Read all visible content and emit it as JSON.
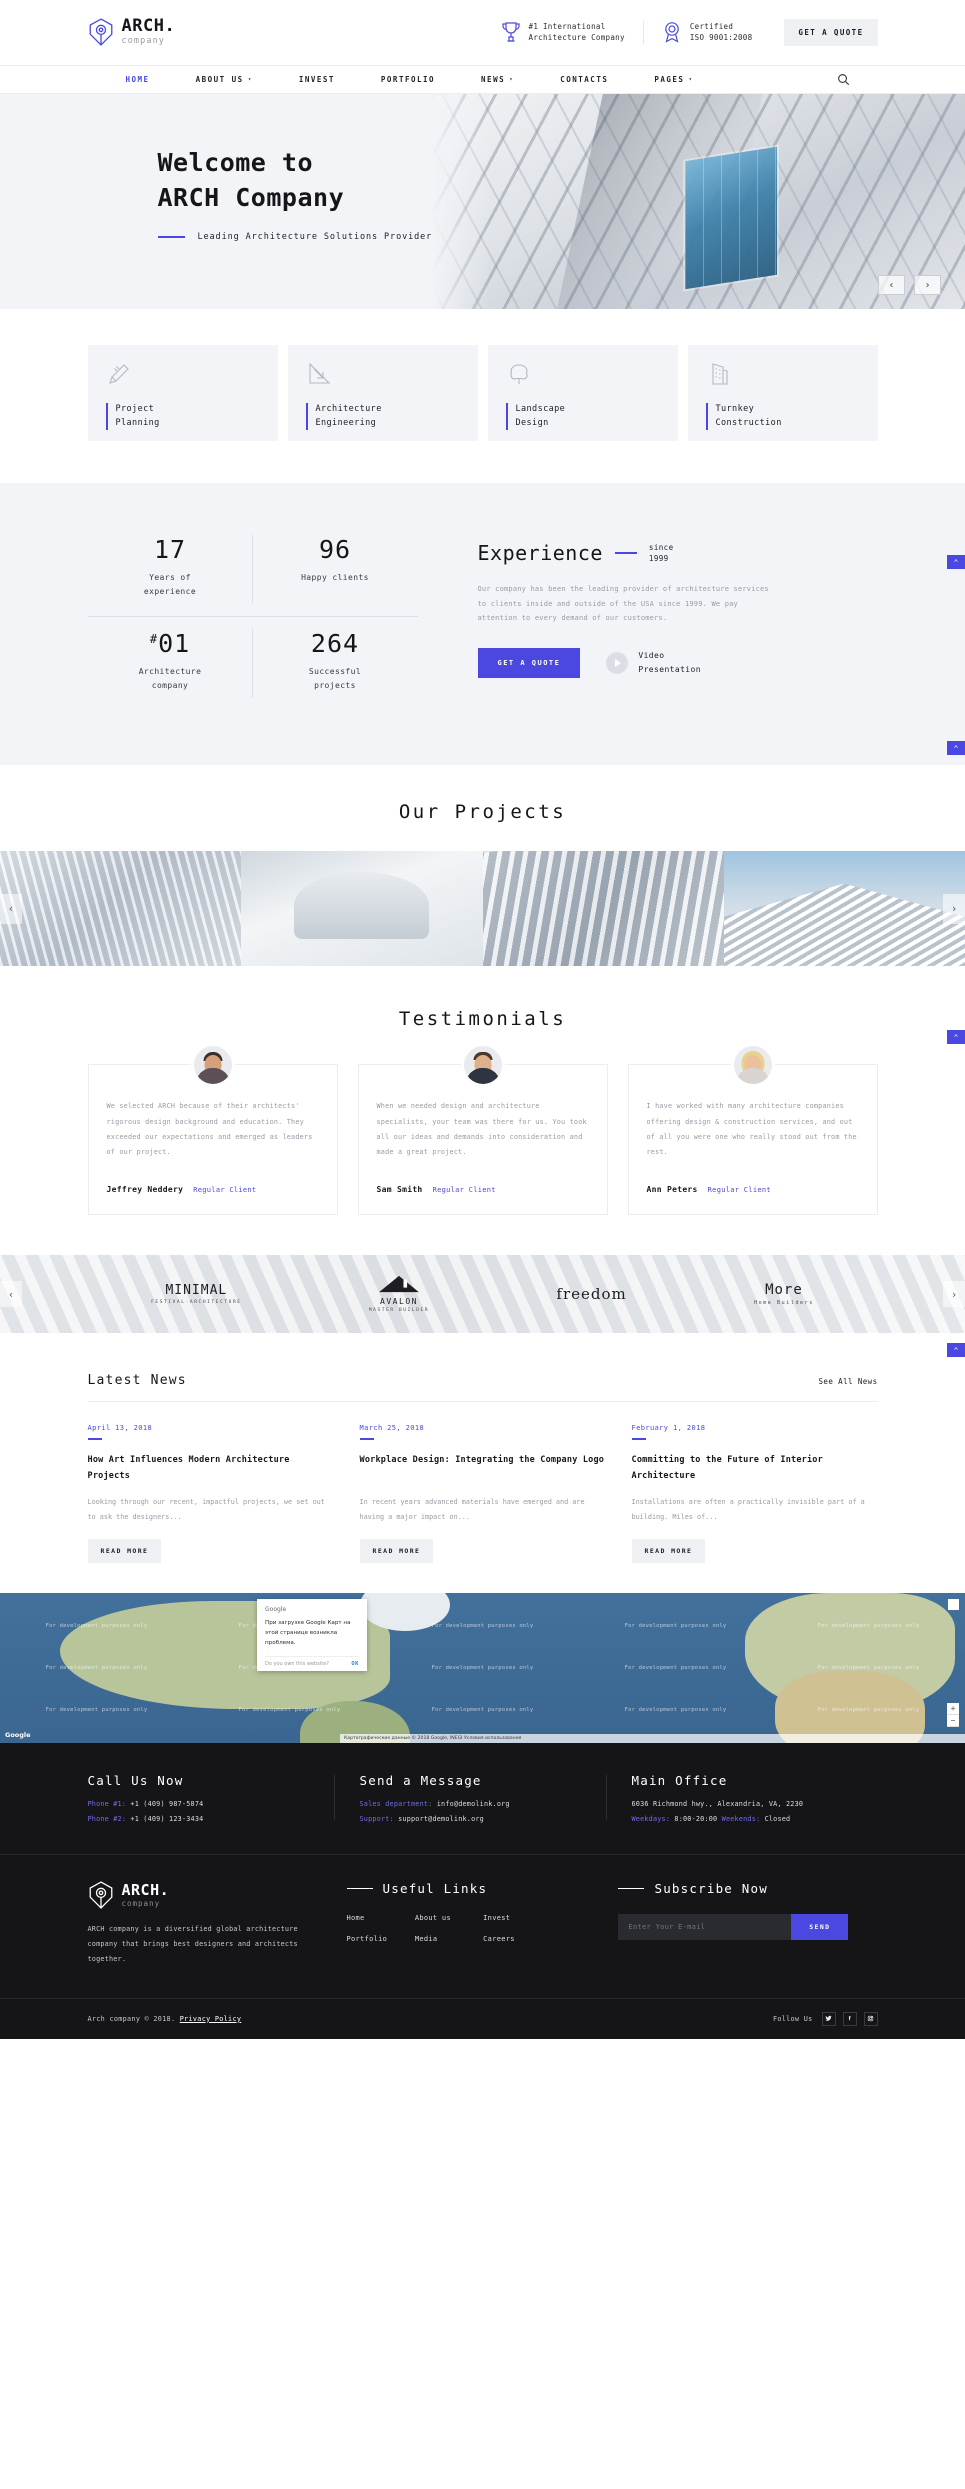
{
  "brand": {
    "name": "ARCH.",
    "sub": "company"
  },
  "topbar": {
    "badges": [
      {
        "icon": "trophy-icon",
        "line1": "#1 International",
        "line2": "Architecture Company"
      },
      {
        "icon": "award-ribbon-icon",
        "line1": "Certified",
        "line2": "ISO 9001:2008"
      }
    ],
    "quote_label": "GET A QUOTE"
  },
  "nav": {
    "items": [
      {
        "label": "HOME",
        "active": true,
        "caret": false
      },
      {
        "label": "ABOUT US",
        "active": false,
        "caret": true
      },
      {
        "label": "INVEST",
        "active": false,
        "caret": false
      },
      {
        "label": "PORTFOLIO",
        "active": false,
        "caret": false
      },
      {
        "label": "NEWS",
        "active": false,
        "caret": true
      },
      {
        "label": "CONTACTS",
        "active": false,
        "caret": false
      },
      {
        "label": "PAGES",
        "active": false,
        "caret": true
      }
    ],
    "search_icon": "search-icon"
  },
  "hero": {
    "title_line1": "Welcome to",
    "title_line2": "ARCH Company",
    "subtitle": "Leading Architecture Solutions Provider",
    "prev": "‹",
    "next": "›"
  },
  "services": [
    {
      "icon": "pencil-ruler-icon",
      "line1": "Project",
      "line2": "Planning"
    },
    {
      "icon": "drafting-arrow-icon",
      "line1": "Architecture",
      "line2": "Engineering"
    },
    {
      "icon": "tree-icon",
      "line1": "Landscape",
      "line2": "Design"
    },
    {
      "icon": "building-icon",
      "line1": "Turnkey",
      "line2": "Construction"
    }
  ],
  "stats": {
    "counters": [
      {
        "number": "17",
        "sup": "",
        "cap1": "Years of",
        "cap2": "experience"
      },
      {
        "number": "96",
        "sup": "",
        "cap1": "Happy clients",
        "cap2": ""
      },
      {
        "number": "01",
        "sup": "#",
        "cap1": "Architecture",
        "cap2": "company"
      },
      {
        "number": "264",
        "sup": "",
        "cap1": "Successful",
        "cap2": "projects"
      }
    ],
    "experience": {
      "title": "Experience",
      "since1": "since",
      "since2": "1999",
      "body": "Our company has been the leading provider of architecture services to clients inside and outside of the USA since 1999. We pay attention to every demand of our customers.",
      "cta": "GET A QUOTE",
      "video1": "Video",
      "video2": "Presentation"
    }
  },
  "projects": {
    "title": "Our Projects",
    "prev": "‹",
    "next": "›"
  },
  "testimonials": {
    "title": "Testimonials",
    "items": [
      {
        "text": "We selected ARCH because of their architects' rigorous design background and education. They exceeded our expectations and emerged as leaders of our project.",
        "name": "Jeffrey Neddery",
        "role": "Regular Client"
      },
      {
        "text": "When we needed design and architecture specialists, your team was there for us. You took all our ideas and demands into consideration and made a great project.",
        "name": "Sam Smith",
        "role": "Regular Client"
      },
      {
        "text": "I have worked with many architecture companies offering design & construction services, and out of all you were one who really stood out from the rest.",
        "name": "Ann Peters",
        "role": "Regular Client"
      }
    ]
  },
  "partners": {
    "prev": "‹",
    "next": "›",
    "items": [
      {
        "name": "MINIMAL",
        "sub": "FESTIVAL·ARCHITECTURE",
        "serif": false
      },
      {
        "name": "AVALON",
        "sub": "MASTER BUILDER",
        "serif": false
      },
      {
        "name": "freedom",
        "sub": "",
        "serif": true
      },
      {
        "name": "More",
        "sub": "Home Builders",
        "serif": false
      }
    ]
  },
  "news": {
    "title": "Latest News",
    "see_all": "See All News",
    "items": [
      {
        "date": "April 13, 2018",
        "headline": "How Art Influences Modern Architecture Projects",
        "excerpt": "Looking through our recent, impactful projects, we set out to ask the designers...",
        "button": "READ MORE"
      },
      {
        "date": "March 25, 2018",
        "headline": "Workplace Design: Integrating the Company Logo",
        "excerpt": "In recent years advanced materials have emerged and are having a major impact on...",
        "button": "READ MORE"
      },
      {
        "date": "February 1, 2018",
        "headline": "Committing to the Future of Interior Architecture",
        "excerpt": "Installations are often a practically invisible part of a building. Miles of...",
        "button": "READ MORE"
      }
    ]
  },
  "map": {
    "dialog": {
      "brand": "Google",
      "message": "При загрузке Google Карт на этой странице возникла проблема.",
      "own": "Do you own this website?",
      "ok": "OK"
    },
    "watermark": "For development purposes only",
    "attribution": "Картографические данные © 2018 Google, INEGI   Условия использования",
    "logo": "Google",
    "zoom_in": "+",
    "zoom_out": "−"
  },
  "footer": {
    "contacts": [
      {
        "title": "Call Us Now",
        "lines": [
          {
            "key": "Phone #1:",
            "value": " +1 (409) 987-5874"
          },
          {
            "key": "Phone #2:",
            "value": " +1 (409) 123-3434"
          }
        ]
      },
      {
        "title": "Send a Message",
        "lines": [
          {
            "key": "Sales department:",
            "value": " info@demolink.org"
          },
          {
            "key": "Support:",
            "value": " support@demolink.org"
          }
        ]
      },
      {
        "title": "Main Office",
        "lines": [
          {
            "key": "",
            "value": "6036 Richmond hwy., Alexandria, VA, 2230"
          },
          {
            "key": "Weekdays:",
            "value": " 8:00-20:00 ",
            "key2": "Weekends:",
            "value2": " Closed"
          }
        ]
      }
    ],
    "about": "ARCH company is a diversified global architecture company that brings best designers and architects together.",
    "links_title": "Useful Links",
    "links": [
      "Home",
      "About us",
      "Invest",
      "Portfolio",
      "Media",
      "Careers"
    ],
    "subscribe_title": "Subscribe Now",
    "subscribe_placeholder": "Enter Your E-mail",
    "subscribe_button": "SEND",
    "copyright_prefix": "Arch company © 2018. ",
    "copyright_link": "Privacy Policy",
    "follow_label": "Follow Us",
    "socials": [
      "twitter-icon",
      "facebook-icon",
      "instagram-icon"
    ]
  },
  "colors": {
    "accent": "#4a48e0",
    "light_bg": "#f2f4f8",
    "dark_bg": "#151518"
  },
  "scroll_up": "⌃"
}
